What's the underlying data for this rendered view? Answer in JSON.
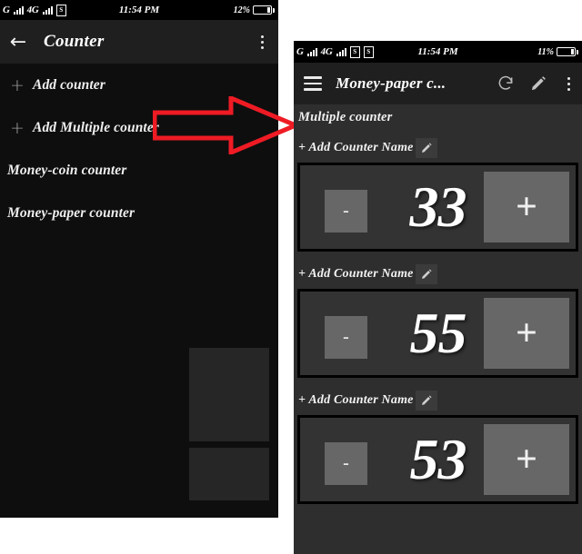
{
  "left_panel": {
    "statusbar": {
      "network_1": "G",
      "network_2": "4G",
      "sd_icon": "S",
      "time": "11:54 PM",
      "battery_percent": "12%"
    },
    "appbar": {
      "back_icon": "back-arrow-icon",
      "title": "Counter",
      "overflow_icon": "overflow-menu-icon"
    },
    "menu_items": [
      {
        "prefix": "+",
        "label": "Add counter",
        "has_prefix": true
      },
      {
        "prefix": "+",
        "label": "Add Multiple counter",
        "has_prefix": true
      },
      {
        "prefix": "",
        "label": "Money-coin counter",
        "has_prefix": false
      },
      {
        "prefix": "",
        "label": "Money-paper counter",
        "has_prefix": false
      }
    ]
  },
  "annotation": {
    "arrow_color": "#ee1b24",
    "arrow_name": "red-pointer-arrow"
  },
  "right_panel": {
    "statusbar": {
      "network_1": "G",
      "network_2": "4G",
      "sd_icon_1": "S",
      "sd_icon_2": "S",
      "time": "11:54 PM",
      "battery_percent": "11%"
    },
    "appbar": {
      "menu_icon": "hamburger-menu-icon",
      "title": "Money-paper c...",
      "refresh_icon": "refresh-icon",
      "edit_icon": "pencil-edit-icon",
      "overflow_icon": "overflow-menu-icon"
    },
    "section_title": "Multiple counter",
    "counters": [
      {
        "add_name_label": "+ Add Counter Name",
        "edit_icon": "pencil-edit-icon",
        "minus_label": "-",
        "value": "33",
        "plus_label": "+"
      },
      {
        "add_name_label": "+ Add Counter Name",
        "edit_icon": "pencil-edit-icon",
        "minus_label": "-",
        "value": "55",
        "plus_label": "+"
      },
      {
        "add_name_label": "+ Add Counter Name",
        "edit_icon": "pencil-edit-icon",
        "minus_label": "-",
        "value": "53",
        "plus_label": "+"
      }
    ]
  }
}
